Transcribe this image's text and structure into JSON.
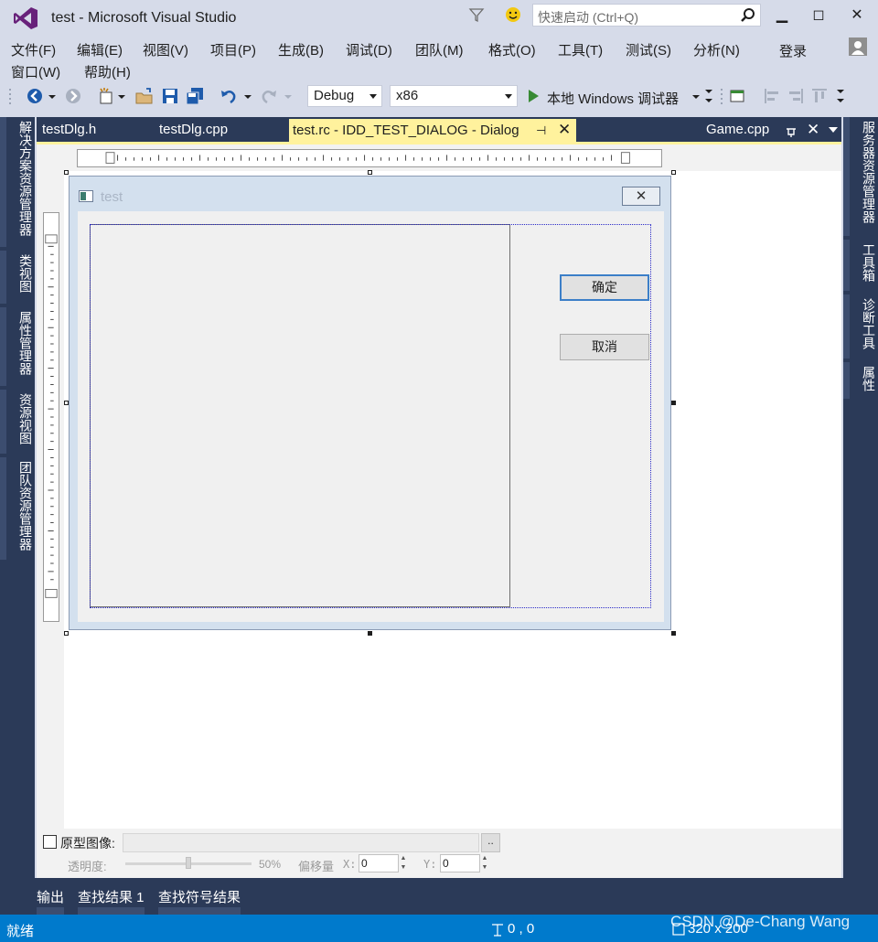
{
  "window": {
    "title": "test - Microsoft Visual Studio",
    "quick_launch_placeholder": "快速启动 (Ctrl+Q)",
    "min_glyph": "▁",
    "max_glyph": "◻",
    "close_glyph": "✕",
    "login_label": "登录"
  },
  "menu": {
    "items": [
      "文件(F)",
      "编辑(E)",
      "视图(V)",
      "项目(P)",
      "生成(B)",
      "调试(D)",
      "团队(M)",
      "格式(O)",
      "工具(T)",
      "测试(S)",
      "分析(N)",
      "窗口(W)",
      "帮助(H)"
    ]
  },
  "toolbar": {
    "config": "Debug",
    "platform": "x86",
    "run_label": "本地 Windows 调试器"
  },
  "tabs": {
    "items": [
      "testDlg.h",
      "testDlg.cpp"
    ],
    "active": "test.rc - IDD_TEST_DIALOG - Dialog",
    "right": "Game.cpp",
    "pin_glyph": "⊣",
    "close_glyph": "✕"
  },
  "left_panels": [
    "解决方案资源管理器",
    "类视图",
    "属性管理器",
    "资源视图",
    "团队资源管理器"
  ],
  "right_panels": [
    "服务器资源管理器",
    "工具箱",
    "诊断工具",
    "属性"
  ],
  "dialog": {
    "title": "test",
    "ok_label": "确定",
    "cancel_label": "取消",
    "close_glyph": "✕"
  },
  "prototype": {
    "label": "原型图像:",
    "browse": "..",
    "transparency_label": "透明度:",
    "transparency_value": "50%",
    "transparency_level": 0.5,
    "offset_label": "偏移量",
    "x_label": "X:",
    "x_value": "0",
    "y_label": "Y:",
    "y_value": "0"
  },
  "bottom_tabs": [
    "输出",
    "查找结果 1",
    "查找符号结果"
  ],
  "status": {
    "text": "就绪",
    "position": "0 , 0",
    "size": "320 x 200"
  },
  "watermark": "CSDN @De-Chang Wang",
  "colors": {
    "chrome": "#d6dbe9",
    "rail": "#2b3a58",
    "active_tab": "#fff29d",
    "status_bar": "#007acc",
    "vs_purple": "#68217a"
  }
}
